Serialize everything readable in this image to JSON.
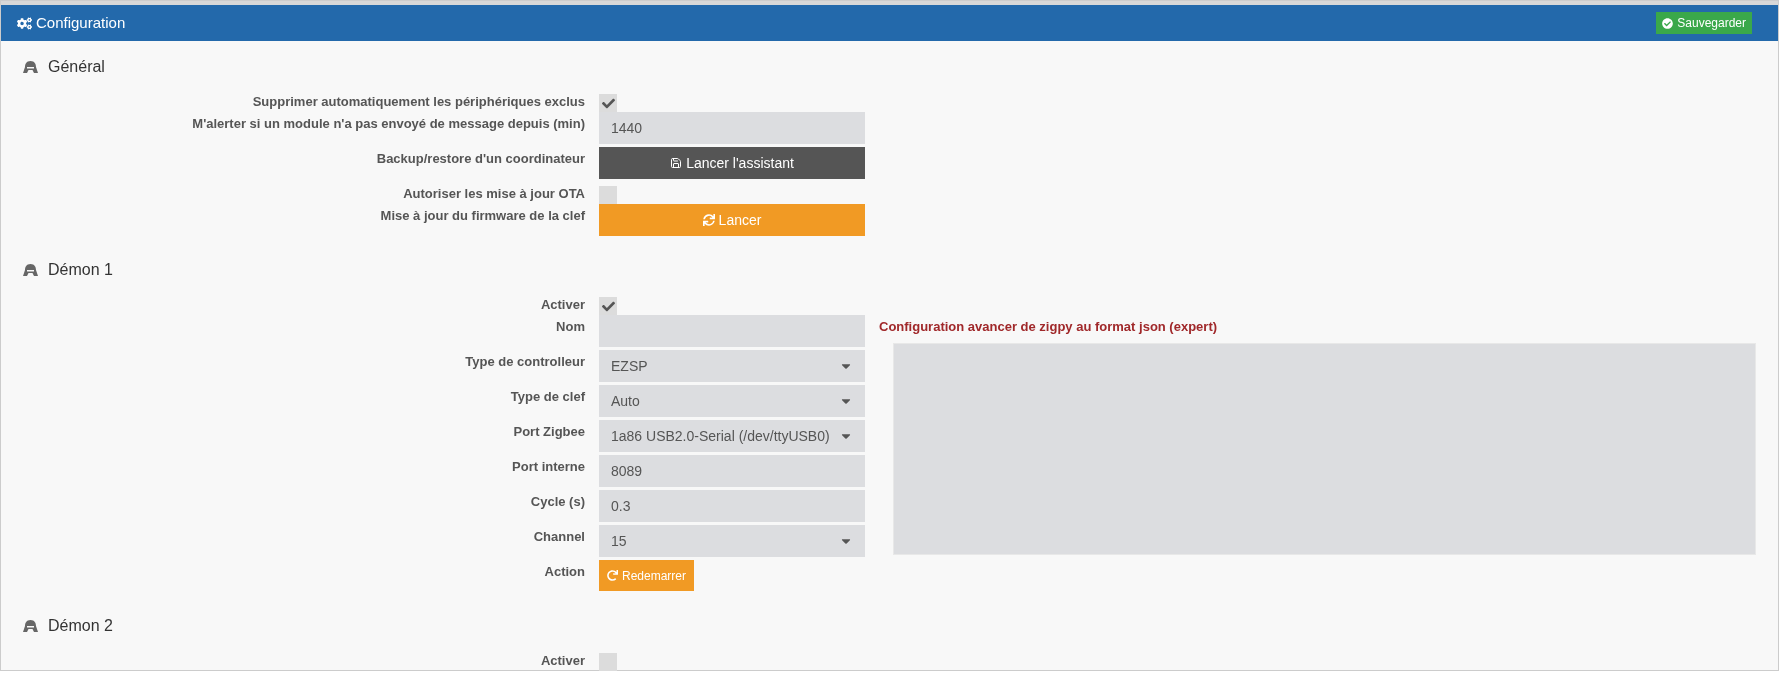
{
  "header": {
    "title": "Configuration",
    "save_button": "Sauvegarder"
  },
  "sections": [
    {
      "title": "Général",
      "fields": [
        {
          "kind": "checkbox",
          "label": "Supprimer automatiquement les périphériques exclus",
          "checked": true
        },
        {
          "kind": "text",
          "label": "M'alerter si un module n'a pas envoyé de message depuis (min)",
          "value": "1440"
        },
        {
          "kind": "wizard",
          "label": "Backup/restore d'un coordinateur",
          "button": "Lancer l'assistant"
        },
        {
          "kind": "checkbox",
          "label": "Autoriser les mise à jour OTA",
          "checked": false
        },
        {
          "kind": "firmware",
          "label": "Mise à jour du firmware de la clef",
          "button": "Lancer"
        }
      ]
    },
    {
      "title": "Démon 1",
      "advanced": {
        "label": "Configuration avancer de zigpy au format json (expert)"
      },
      "fields": [
        {
          "kind": "checkbox",
          "label": "Activer",
          "checked": true
        },
        {
          "kind": "text",
          "label": "Nom"
        },
        {
          "kind": "select",
          "label": "Type de controlleur",
          "value": "EZSP"
        },
        {
          "kind": "select",
          "label": "Type de clef",
          "value": "Auto"
        },
        {
          "kind": "select",
          "label": "Port Zigbee",
          "value": "1a86 USB2.0-Serial (/dev/ttyUSB0)"
        },
        {
          "kind": "text",
          "label": "Port interne",
          "value": "8089"
        },
        {
          "kind": "text",
          "label": "Cycle (s)",
          "value": "0.3"
        },
        {
          "kind": "select",
          "label": "Channel",
          "value": "15"
        },
        {
          "kind": "restart",
          "label": "Action",
          "button": "Redemarrer"
        }
      ]
    },
    {
      "title": "Démon 2",
      "fields": [
        {
          "kind": "checkbox",
          "label": "Activer",
          "checked": false
        }
      ]
    }
  ]
}
